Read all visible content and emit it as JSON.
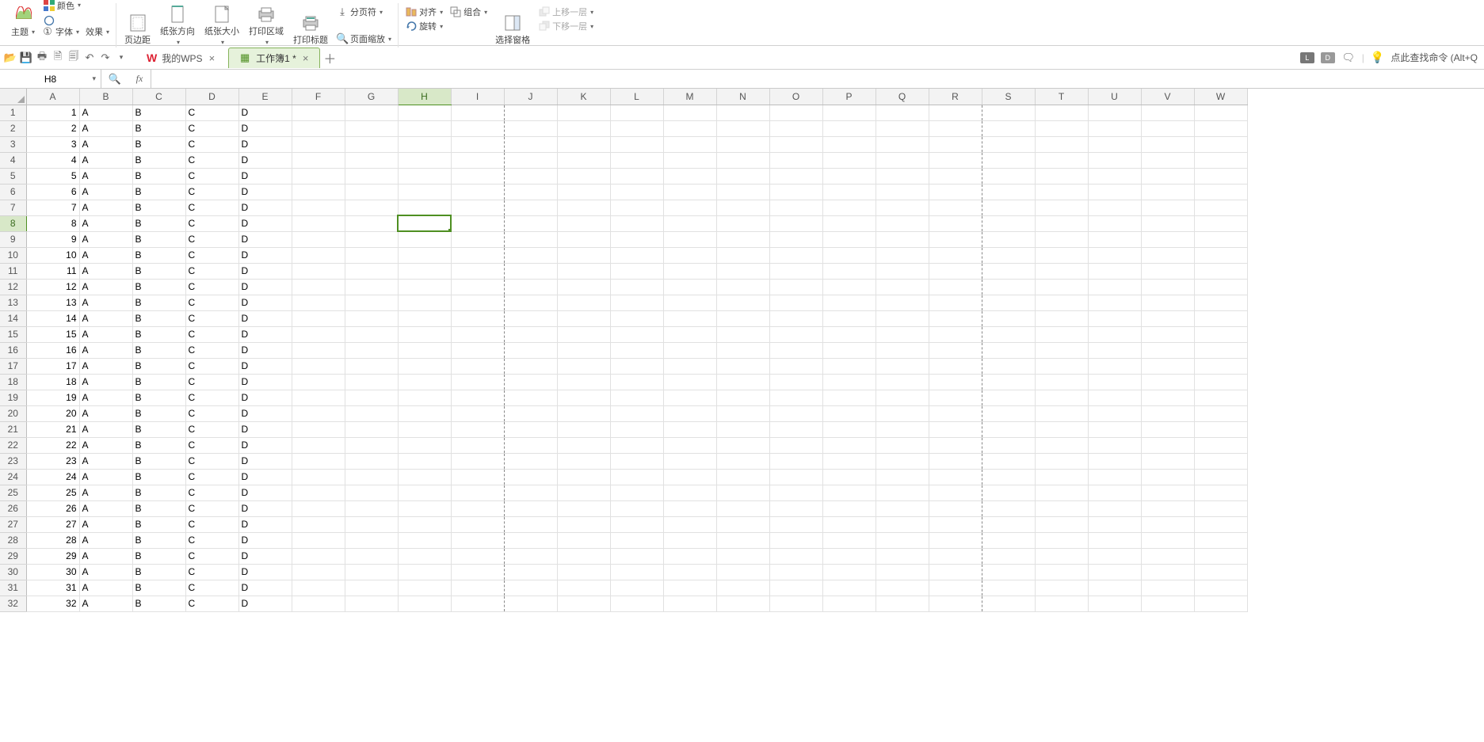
{
  "ribbon": {
    "theme": "主题",
    "font": "字体",
    "effect": "效果",
    "color": "颜色",
    "margins": "页边距",
    "orientation": "纸张方向",
    "size": "纸张大小",
    "print_area": "打印区域",
    "print_titles": "打印标题",
    "page_zoom": "页面缩放",
    "breaks": "分页符",
    "align": "对齐",
    "rotate": "旋转",
    "group": "组合",
    "selection_pane": "选择窗格",
    "bring_forward": "上移一层",
    "send_backward": "下移一层"
  },
  "tabs": {
    "home": "我的WPS",
    "workbook": "工作簿1 *"
  },
  "right": {
    "hint": "点此查找命令 (Alt+Q",
    "chip_l": "L",
    "chip_d": "D"
  },
  "namebox": "H8",
  "fx": "fx",
  "columns": [
    "A",
    "B",
    "C",
    "D",
    "E",
    "F",
    "G",
    "H",
    "I",
    "J",
    "K",
    "L",
    "M",
    "N",
    "O",
    "P",
    "Q",
    "R",
    "S",
    "T",
    "U",
    "V",
    "W"
  ],
  "rowCount": 32,
  "pageBreakCols": [
    "I",
    "R"
  ],
  "selected": {
    "col": "H",
    "row": 8
  },
  "data": {
    "A": "num-row",
    "B": "A",
    "C": "B",
    "D": "C",
    "E": "D"
  }
}
